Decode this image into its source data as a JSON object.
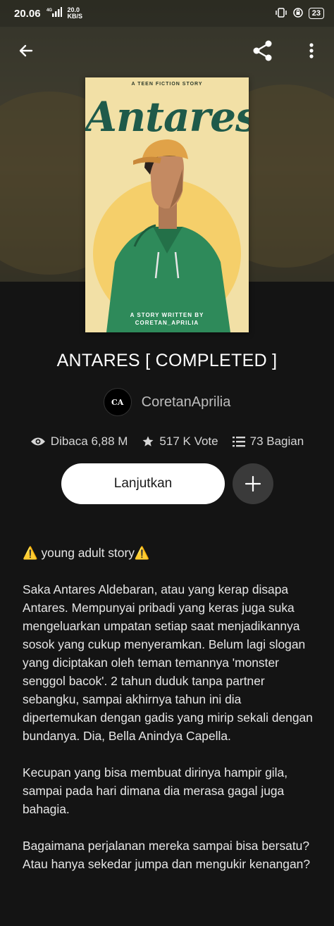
{
  "status_bar": {
    "time": "20.06",
    "network_type": "4G",
    "speed_value": "20.0",
    "speed_unit": "KB/S",
    "battery": "23"
  },
  "app_bar": {
    "back_icon": "arrow-left-icon",
    "share_icon": "share-icon",
    "menu_icon": "more-vertical-icon"
  },
  "cover": {
    "tag": "A TEEN FICTION STORY",
    "title": "Antares",
    "foot_line1": "A STORY WRITTEN BY",
    "foot_line2": "CORETAN_APRILIA"
  },
  "story": {
    "title": "ANTARES  [ COMPLETED ]",
    "author": "CoretanAprilia",
    "avatar_text": "CA"
  },
  "stats": {
    "reads": "Dibaca 6,88 M",
    "votes": "517 K Vote",
    "parts": "73 Bagian"
  },
  "actions": {
    "continue_label": "Lanjutkan",
    "add_icon": "plus-icon"
  },
  "description": {
    "p1": "⚠️ young adult story⚠️",
    "p2": "Saka Antares Aldebaran, atau yang kerap disapa Antares. Mempunyai pribadi yang keras juga suka mengeluarkan umpatan setiap saat menjadikannya sosok yang cukup menyeramkan. Belum lagi slogan yang diciptakan oleh teman temannya 'monster senggol bacok'. 2 tahun duduk tanpa partner sebangku, sampai akhirnya tahun ini dia dipertemukan dengan gadis yang mirip sekali dengan bundanya. Dia, Bella Anindya Capella.",
    "p3": "Kecupan yang bisa membuat dirinya hampir gila, sampai pada hari dimana dia merasa gagal juga bahagia.",
    "p4": "Bagaimana perjalanan mereka sampai bisa bersatu? Atau hanya sekedar jumpa dan mengukir kenangan?"
  }
}
